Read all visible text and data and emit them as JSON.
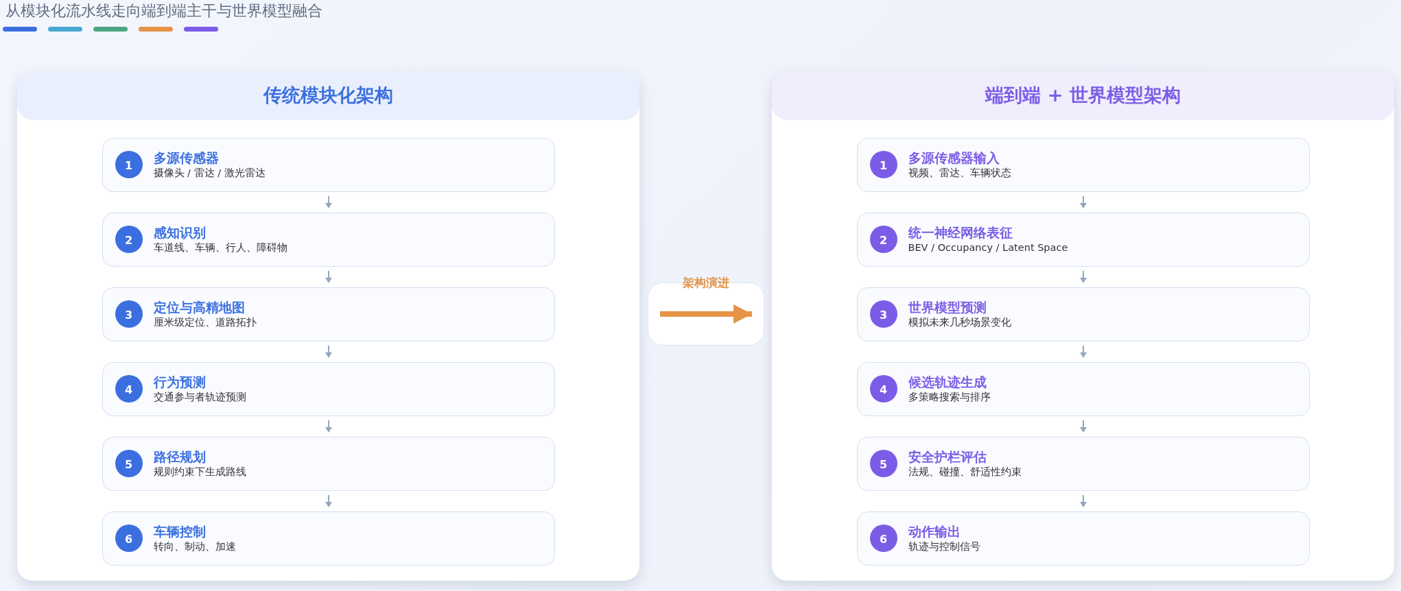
{
  "title": "从模块化流水线走向端到端主干与世界模型融合",
  "accent_bars": [
    {
      "color": "#3b6fe0"
    },
    {
      "color": "#4aa8d0"
    },
    {
      "color": "#4ea585"
    },
    {
      "color": "#e59346"
    },
    {
      "color": "#7b5ce6"
    }
  ],
  "columns": [
    {
      "title": "传统模块化架构",
      "color": "#3b6fe0",
      "steps": [
        {
          "number": "1",
          "title": "多源传感器",
          "subtitle": "摄像头 / 雷达 / 激光雷达"
        },
        {
          "number": "2",
          "title": "感知识别",
          "subtitle": "车道线、车辆、行人、障碍物"
        },
        {
          "number": "3",
          "title": "定位与高精地图",
          "subtitle": "厘米级定位、道路拓扑"
        },
        {
          "number": "4",
          "title": "行为预测",
          "subtitle": "交通参与者轨迹预测"
        },
        {
          "number": "5",
          "title": "路径规划",
          "subtitle": "规则约束下生成路线"
        },
        {
          "number": "6",
          "title": "车辆控制",
          "subtitle": "转向、制动、加速"
        }
      ]
    },
    {
      "title": "端到端 + 世界模型架构",
      "color": "#7b5ce6",
      "steps": [
        {
          "number": "1",
          "title": "多源传感器输入",
          "subtitle": "视频、雷达、车辆状态"
        },
        {
          "number": "2",
          "title": "统一神经网络表征",
          "subtitle": "BEV / Occupancy / Latent Space"
        },
        {
          "number": "3",
          "title": "世界模型预测",
          "subtitle": "模拟未来几秒场景变化"
        },
        {
          "number": "4",
          "title": "候选轨迹生成",
          "subtitle": "多策略搜索与排序"
        },
        {
          "number": "5",
          "title": "安全护栏评估",
          "subtitle": "法规、碰撞、舒适性约束"
        },
        {
          "number": "6",
          "title": "动作输出",
          "subtitle": "轨迹与控制信号"
        }
      ]
    }
  ],
  "transition": {
    "label": "架构演进",
    "color": "#e59346"
  }
}
